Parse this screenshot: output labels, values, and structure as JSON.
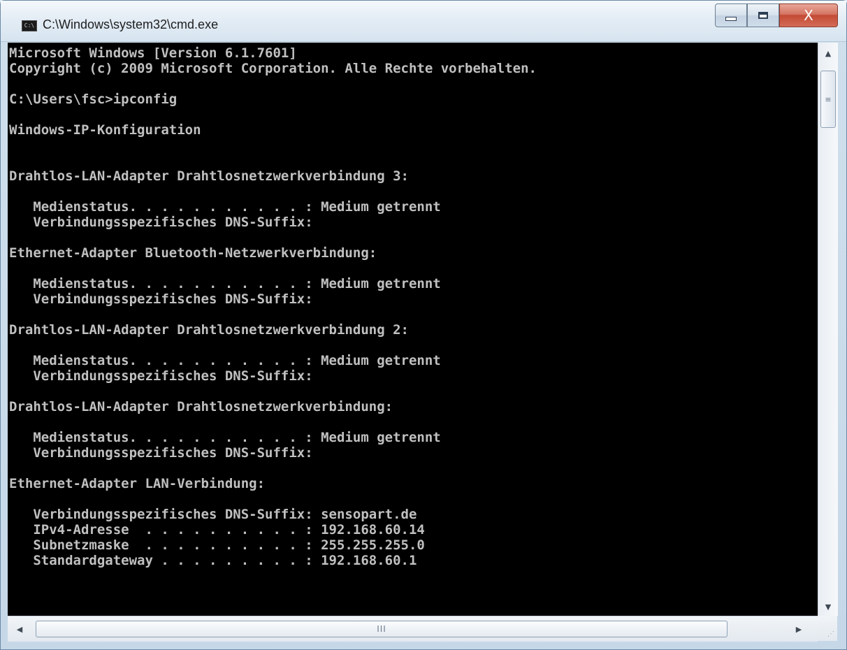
{
  "window": {
    "title": "C:\\Windows\\system32\\cmd.exe",
    "app_icon_text": "C:\\",
    "controls": {
      "minimize_icon": "minimize-icon",
      "maximize_icon": "maximize-icon",
      "close_label": "X"
    }
  },
  "console": {
    "background": "#000000",
    "foreground": "#c0c0c0",
    "lines": [
      "Microsoft Windows [Version 6.1.7601]",
      "Copyright (c) 2009 Microsoft Corporation. Alle Rechte vorbehalten.",
      "",
      "C:\\Users\\fsc>ipconfig",
      "",
      "Windows-IP-Konfiguration",
      "",
      "",
      "Drahtlos-LAN-Adapter Drahtlosnetzwerkverbindung 3:",
      "",
      "   Medienstatus. . . . . . . . . . . : Medium getrennt",
      "   Verbindungsspezifisches DNS-Suffix:",
      "",
      "Ethernet-Adapter Bluetooth-Netzwerkverbindung:",
      "",
      "   Medienstatus. . . . . . . . . . . : Medium getrennt",
      "   Verbindungsspezifisches DNS-Suffix:",
      "",
      "Drahtlos-LAN-Adapter Drahtlosnetzwerkverbindung 2:",
      "",
      "   Medienstatus. . . . . . . . . . . : Medium getrennt",
      "   Verbindungsspezifisches DNS-Suffix:",
      "",
      "Drahtlos-LAN-Adapter Drahtlosnetzwerkverbindung:",
      "",
      "   Medienstatus. . . . . . . . . . . : Medium getrennt",
      "   Verbindungsspezifisches DNS-Suffix:",
      "",
      "Ethernet-Adapter LAN-Verbindung:",
      "",
      "   Verbindungsspezifisches DNS-Suffix: sensopart.de",
      "   IPv4-Adresse  . . . . . . . . . . : 192.168.60.14",
      "   Subnetzmaske  . . . . . . . . . . : 255.255.255.0",
      "   Standardgateway . . . . . . . . . : 192.168.60.1"
    ]
  },
  "scrollbars": {
    "vertical_up_icon": "scroll-up-arrow-icon",
    "vertical_down_icon": "scroll-down-arrow-icon",
    "vertical_thumb_grip": "≡",
    "horizontal_left_icon": "scroll-left-arrow-icon",
    "horizontal_right_icon": "scroll-right-arrow-icon",
    "horizontal_thumb_grip": "III"
  }
}
